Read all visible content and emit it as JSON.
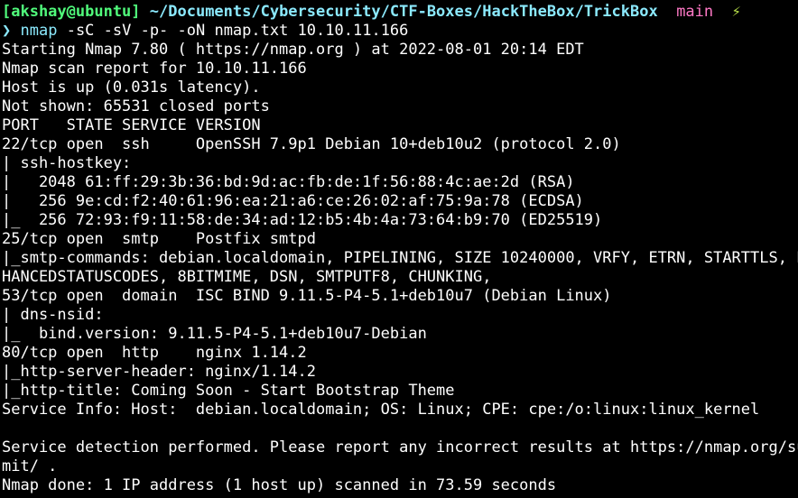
{
  "prompt": {
    "user_host": "[akshay@ubuntu]",
    "path": "~/Documents/Cybersecurity/CTF-Boxes/HackTheBox/TrickBox",
    "branch": "main",
    "status_icon": "⚡",
    "arrow": "❯",
    "command": "nmap",
    "args": "-sC -sV -p- -oN nmap.txt 10.10.11.166"
  },
  "output_lines": [
    "Starting Nmap 7.80 ( https://nmap.org ) at 2022-08-01 20:14 EDT",
    "Nmap scan report for 10.10.11.166",
    "Host is up (0.031s latency).",
    "Not shown: 65531 closed ports",
    "PORT   STATE SERVICE VERSION",
    "22/tcp open  ssh     OpenSSH 7.9p1 Debian 10+deb10u2 (protocol 2.0)",
    "| ssh-hostkey: ",
    "|   2048 61:ff:29:3b:36:bd:9d:ac:fb:de:1f:56:88:4c:ae:2d (RSA)",
    "|   256 9e:cd:f2:40:61:96:ea:21:a6:ce:26:02:af:75:9a:78 (ECDSA)",
    "|_  256 72:93:f9:11:58:de:34:ad:12:b5:4b:4a:73:64:b9:70 (ED25519)",
    "25/tcp open  smtp    Postfix smtpd",
    "|_smtp-commands: debian.localdomain, PIPELINING, SIZE 10240000, VRFY, ETRN, STARTTLS, EN",
    "HANCEDSTATUSCODES, 8BITMIME, DSN, SMTPUTF8, CHUNKING, ",
    "53/tcp open  domain  ISC BIND 9.11.5-P4-5.1+deb10u7 (Debian Linux)",
    "| dns-nsid: ",
    "|_  bind.version: 9.11.5-P4-5.1+deb10u7-Debian",
    "80/tcp open  http    nginx 1.14.2",
    "|_http-server-header: nginx/1.14.2",
    "|_http-title: Coming Soon - Start Bootstrap Theme",
    "Service Info: Host:  debian.localdomain; OS: Linux; CPE: cpe:/o:linux:linux_kernel",
    "",
    "Service detection performed. Please report any incorrect results at https://nmap.org/sub",
    "mit/ .",
    "Nmap done: 1 IP address (1 host up) scanned in 73.59 seconds"
  ]
}
